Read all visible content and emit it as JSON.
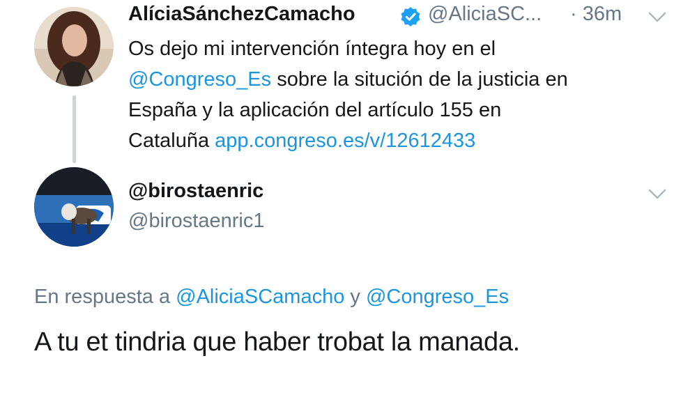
{
  "tweet1": {
    "author_name": "AlíciaSánchezCamacho",
    "handle": "@AliciaSC...",
    "time": "· 36m",
    "text_1": "Os dejo mi intervención íntegra hoy en el",
    "mention": "@Congreso_Es",
    "text_2": " sobre la situción de la justicia en",
    "text_3": "España y la aplicación del artículo 155 en",
    "text_4": "Cataluña ",
    "link": "app.congreso.es/v/12612433"
  },
  "tweet2": {
    "author_name": "@birostaenric",
    "handle": "@birostaenric1",
    "reply_prefix": "En respuesta a ",
    "reply_mention_1": "@AliciaSCamacho",
    "reply_and": " y ",
    "reply_mention_2": "@Congreso_Es",
    "text": "A tu et tindria que haber trobat la manada."
  },
  "colors": {
    "link": "#1b95e0",
    "verified": "#1da1f2",
    "gray_text": "#657786"
  }
}
